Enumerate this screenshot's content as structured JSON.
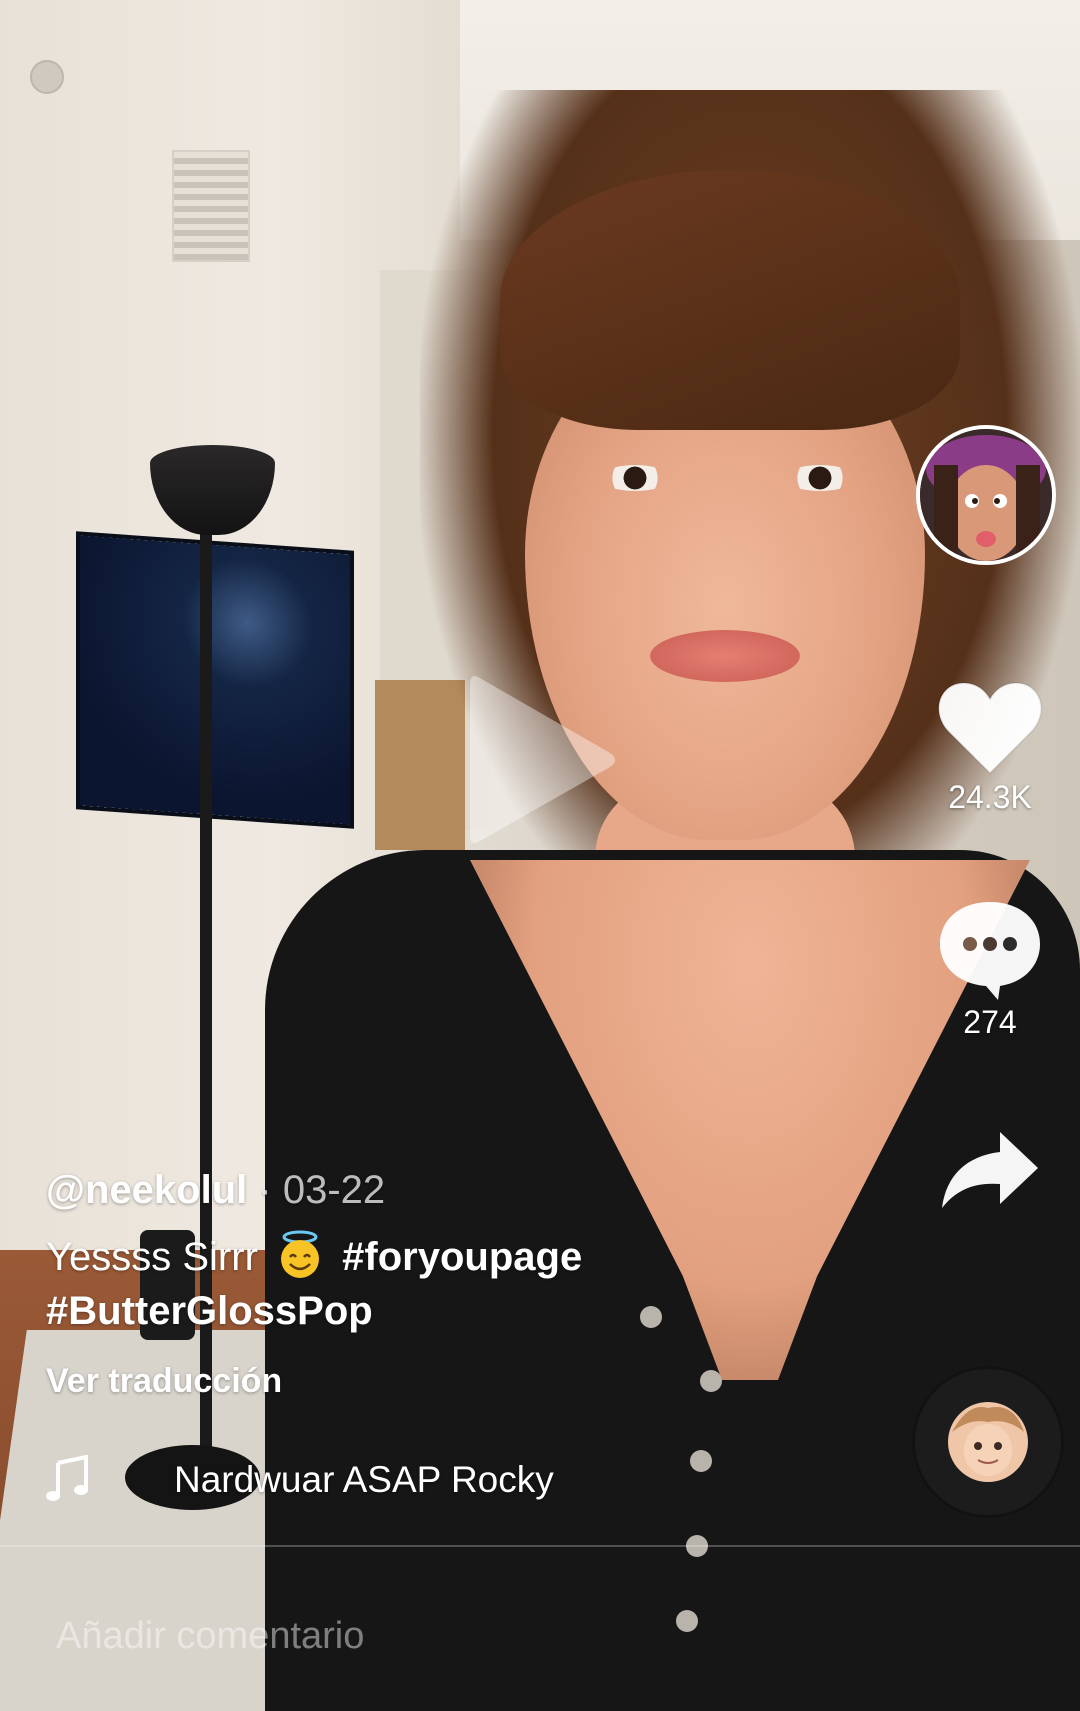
{
  "video": {
    "author": "@neekolul",
    "date_separator": " · ",
    "date": "03-22",
    "caption_text": "Yessss Sirrr",
    "caption_emoji": "smiling-face-with-halo",
    "hashtags": [
      "#foryoupage",
      "#ButterGlossPop"
    ],
    "translate_link": "Ver traducción",
    "music_title": "Nardwuar ASAP Rocky",
    "paused": true
  },
  "actions": {
    "likes": "24.3K",
    "comments": "274"
  },
  "icons": {
    "like": "heart-icon",
    "comment": "comment-bubble-icon",
    "share": "share-arrow-icon",
    "music": "music-note-icon",
    "play": "play-icon"
  },
  "comment_box": {
    "placeholder": "Añadir comentario"
  },
  "colors": {
    "text": "#ffffff",
    "muted": "#ffffffb8",
    "play_overlay": "#ffffff66"
  }
}
